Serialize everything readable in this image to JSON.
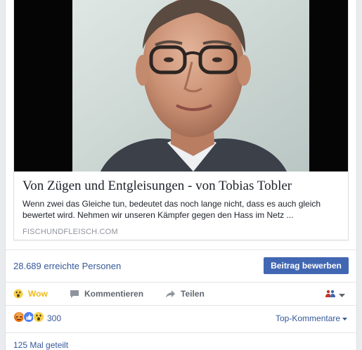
{
  "link_preview": {
    "image_alt": "Porträt eines Mannes mit Brille",
    "title": "Von Zügen und Entgleisungen - von Tobias Tobler",
    "description": "Wenn zwei das Gleiche tun, bedeutet das noch lange nicht, dass es auch gleich bewertet wird. Nehmen wir unseren Kämpfer gegen den Hass im Netz ...",
    "domain": "FISCHUNDFLEISCH.COM"
  },
  "insights": {
    "reach_text": "28.689 erreichte Personen",
    "boost_label": "Beitrag bewerben"
  },
  "actions": {
    "wow_label": "Wow",
    "comment_label": "Kommentieren",
    "share_label": "Teilen"
  },
  "reactions": {
    "icons": [
      "angry-icon",
      "like-icon",
      "wow-icon"
    ],
    "count": "300",
    "sort_label": "Top-Kommentare"
  },
  "shares": {
    "text": "125 Mal geteilt"
  },
  "colors": {
    "link_blue": "#365899",
    "button_blue": "#4267b2",
    "wow_yellow": "#f0ba15",
    "muted_gray": "#606770"
  }
}
